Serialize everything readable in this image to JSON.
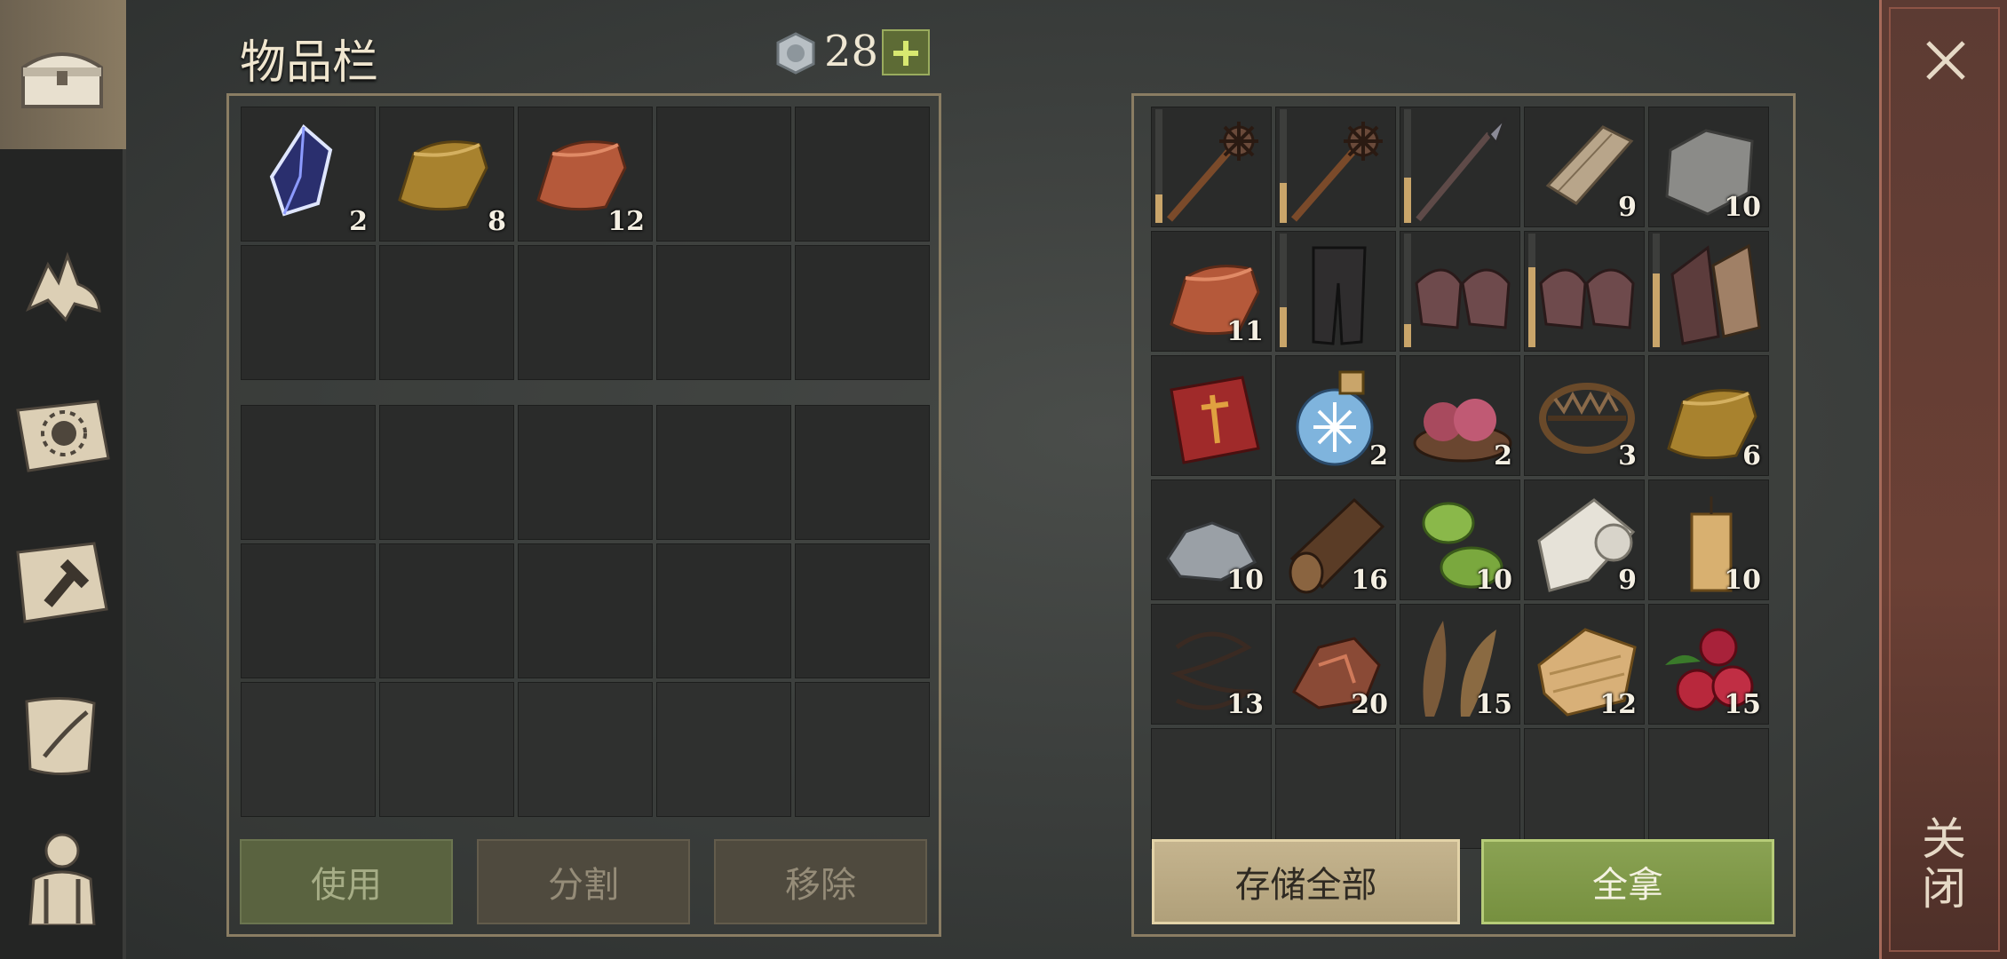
{
  "inventory": {
    "title": "物品栏",
    "currency": "28",
    "slots": [
      {
        "icon": "crystal-icon",
        "qty": "2"
      },
      {
        "icon": "bronze-ingot-icon",
        "qty": "8"
      },
      {
        "icon": "copper-ingot-icon",
        "qty": "12"
      },
      {},
      {},
      {},
      {},
      {},
      {},
      {}
    ],
    "buttons": {
      "use": "使用",
      "split": "分割",
      "remove": "移除"
    }
  },
  "storage": {
    "slots": [
      {
        "icon": "spiked-mace-icon",
        "durability": 0.25
      },
      {
        "icon": "spiked-mace-icon",
        "durability": 0.35
      },
      {
        "icon": "spear-icon",
        "durability": 0.4
      },
      {
        "icon": "wood-plank-icon",
        "qty": "9"
      },
      {
        "icon": "stone-block-icon",
        "qty": "10"
      },
      {
        "icon": "copper-ingot-icon",
        "qty": "11"
      },
      {
        "icon": "leather-pants-icon",
        "durability": 0.35
      },
      {
        "icon": "chainmail-gloves-icon",
        "durability": 0.2
      },
      {
        "icon": "chainmail-gloves-icon",
        "durability": 0.7
      },
      {
        "icon": "chainmail-gauntlets-icon",
        "durability": 0.65
      },
      {
        "icon": "red-book-icon"
      },
      {
        "icon": "frost-potion-icon",
        "qty": "2"
      },
      {
        "icon": "raw-meat-bowl-icon",
        "qty": "2"
      },
      {
        "icon": "bear-trap-icon",
        "qty": "3"
      },
      {
        "icon": "bronze-ingot-icon",
        "qty": "6"
      },
      {
        "icon": "iron-ore-icon",
        "qty": "10"
      },
      {
        "icon": "log-icon",
        "qty": "16"
      },
      {
        "icon": "plant-fiber-icon",
        "qty": "10"
      },
      {
        "icon": "cloth-roll-icon",
        "qty": "9"
      },
      {
        "icon": "candle-icon",
        "qty": "10"
      },
      {
        "icon": "wire-icon",
        "qty": "13"
      },
      {
        "icon": "copper-ore-icon",
        "qty": "20"
      },
      {
        "icon": "dried-leaves-icon",
        "qty": "15"
      },
      {
        "icon": "leather-icon",
        "qty": "12"
      },
      {
        "icon": "berries-icon",
        "qty": "15"
      }
    ],
    "buttons": {
      "store_all": "存储全部",
      "take_all": "全拿"
    }
  },
  "close": {
    "label": "关闭"
  },
  "sidebar": [
    "chest-icon",
    "wolf-icon",
    "sun-book-icon",
    "hammer-map-icon",
    "scroll-quill-icon",
    "backpack-character-icon"
  ],
  "colors": {
    "accent_green": "#8aa253",
    "frame": "#8a7d63",
    "close_bar": "#5c3b33"
  }
}
